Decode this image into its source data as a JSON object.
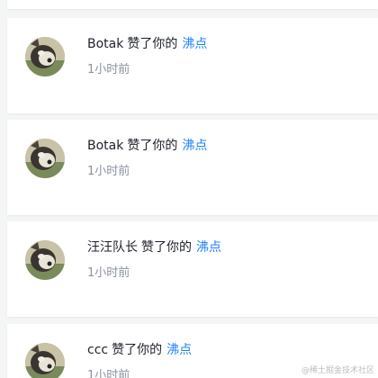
{
  "notifications": [
    {
      "user": "Botak",
      "action": "赞了你的",
      "target": "沸点",
      "time": "1小时前"
    },
    {
      "user": "Botak",
      "action": "赞了你的",
      "target": "沸点",
      "time": "1小时前"
    },
    {
      "user": "汪汪队长",
      "action": "赞了你的",
      "target": "沸点",
      "time": "1小时前"
    },
    {
      "user": "ccc",
      "action": "赞了你的",
      "target": "沸点",
      "time": "1小时前"
    }
  ],
  "watermark": "@稀土掘金技术社区",
  "colors": {
    "link": "#1e80ff",
    "text": "#1d2129",
    "muted": "#8a919f",
    "background": "#f4f5f5"
  }
}
